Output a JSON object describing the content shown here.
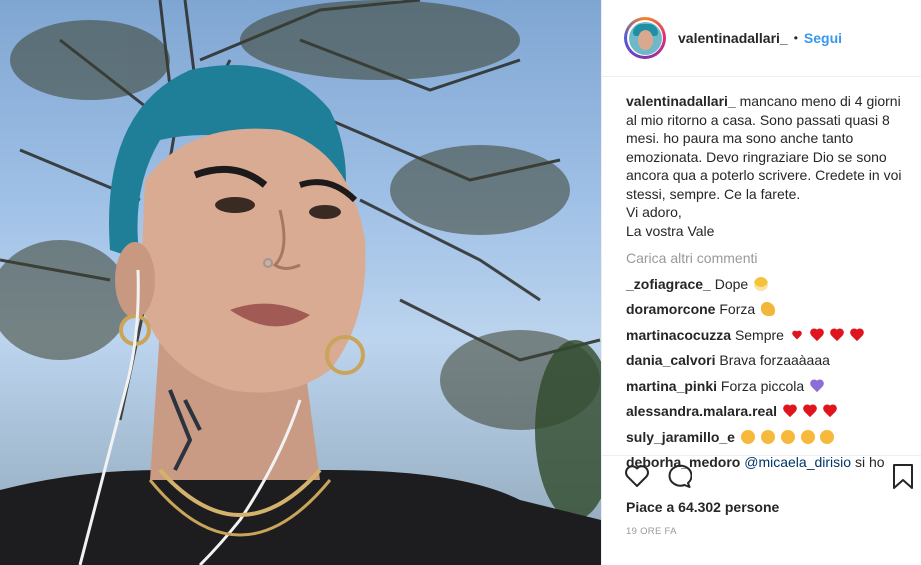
{
  "post": {
    "username": "valentinadallari_",
    "separator": "•",
    "follow_label": "Segui",
    "caption_lines": [
      "mancano meno di 4 giorni al mio ritorno a casa. Sono passati quasi 8 mesi. ho paura ma sono anche tanto emozionata. Devo ringraziare Dio se sono ancora qua a poterlo scrivere. Credete in voi stessi, sempre. Ce la farete.",
      "Vi adoro,",
      "La vostra Vale"
    ],
    "load_more_label": "Carica altri commenti",
    "comments": [
      {
        "user": "_zofiagrace_",
        "text": "Dope",
        "emoji": [
          "grin-face"
        ]
      },
      {
        "user": "doramorcone",
        "text": "Forza",
        "emoji": [
          "flexed-biceps"
        ]
      },
      {
        "user": "martinacocuzza",
        "text": "Sempre",
        "emoji": [
          "black-heart",
          "red-hearts",
          "red-hearts",
          "red-hearts"
        ]
      },
      {
        "user": "dania_calvori",
        "text": "Brava forzaaàaaa",
        "emoji": []
      },
      {
        "user": "martina_pinki",
        "text": "Forza piccola",
        "emoji": [
          "purple-heart"
        ]
      },
      {
        "user": "alessandra.malara.real",
        "text": "",
        "emoji": [
          "red-heart",
          "red-heart",
          "red-heart"
        ]
      },
      {
        "user": "suly_jaramillo_e",
        "text": "",
        "emoji": [
          "kiss-face",
          "kiss-face",
          "kiss-face",
          "kiss-face",
          "kiss-face"
        ]
      },
      {
        "user": "deborha_medoro",
        "mention": "@micaela_dirisio",
        "text": "si ho"
      }
    ],
    "likes_label": "Piace a 64.302 persone",
    "time_label": "19 ORE FA",
    "icons": {
      "like": "heart-outline-icon",
      "comment": "speech-bubble-icon",
      "save": "bookmark-icon"
    },
    "colors": {
      "follow": "#3897f0",
      "mention": "#003569",
      "muted": "#999999",
      "heart": "#e0141c"
    }
  }
}
